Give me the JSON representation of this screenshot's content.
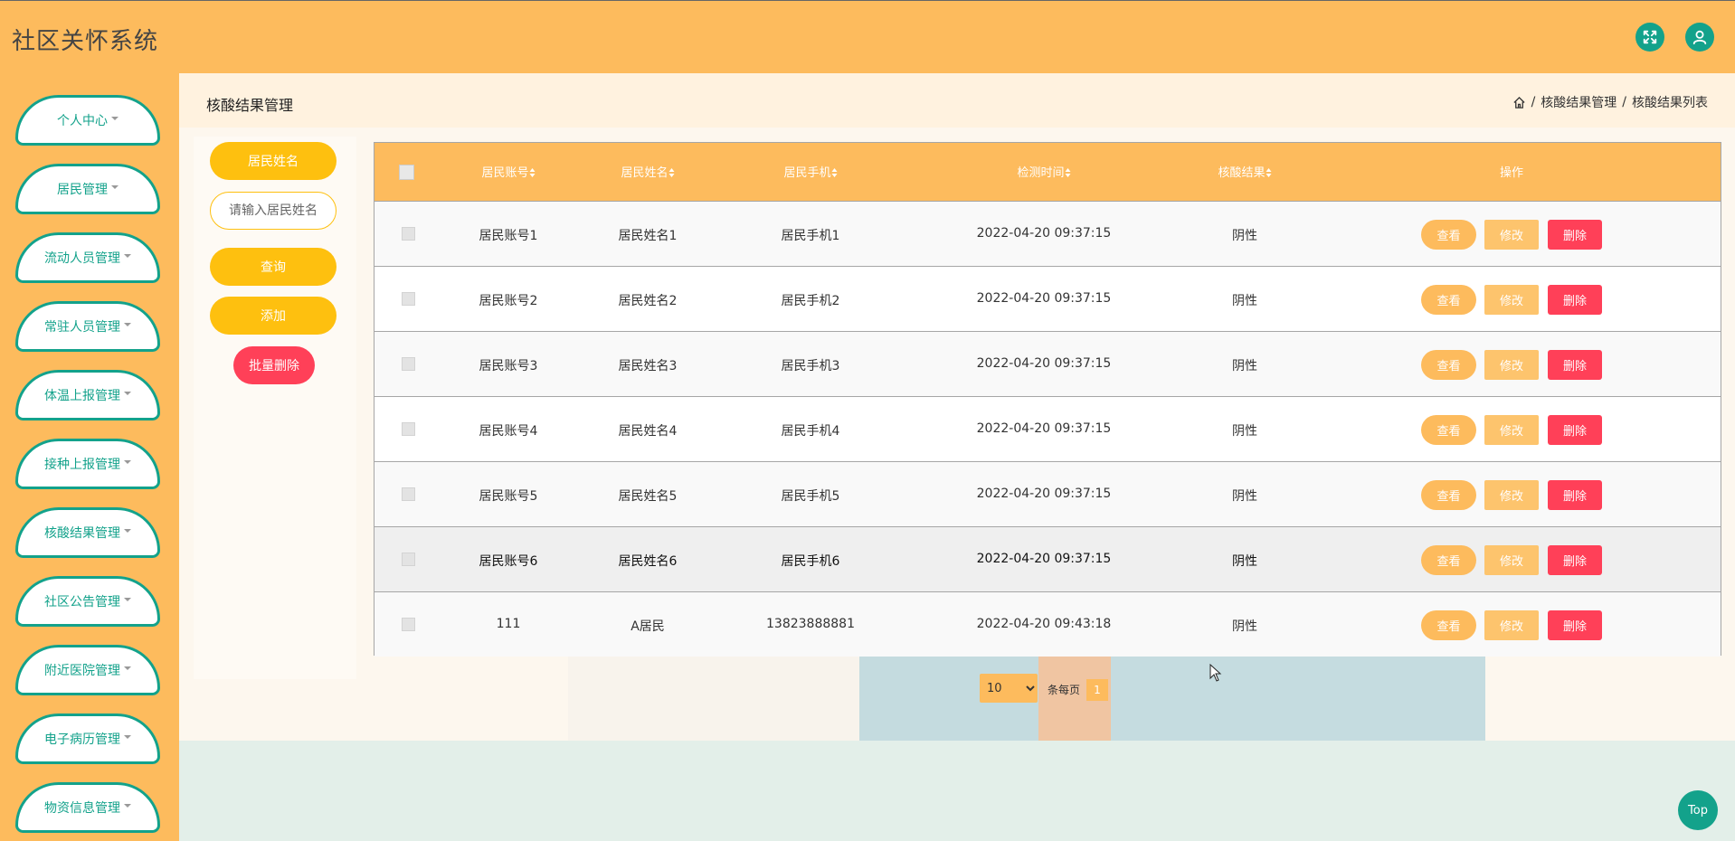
{
  "header": {
    "app_title": "社区关怀系统",
    "accent": "#fdbb5d",
    "teal": "#13a28b",
    "icons": [
      "fullscreen-icon",
      "user-icon"
    ]
  },
  "sidebar": {
    "items": [
      {
        "label": "个人中心"
      },
      {
        "label": "居民管理"
      },
      {
        "label": "流动人员管理"
      },
      {
        "label": "常驻人员管理"
      },
      {
        "label": "体温上报管理"
      },
      {
        "label": "接种上报管理"
      },
      {
        "label": "核酸结果管理"
      },
      {
        "label": "社区公告管理"
      },
      {
        "label": "附近医院管理"
      },
      {
        "label": "电子病历管理"
      },
      {
        "label": "物资信息管理"
      }
    ]
  },
  "page": {
    "title": "核酸结果管理",
    "breadcrumb": [
      "核酸结果管理",
      "核酸结果列表"
    ],
    "separator": "/"
  },
  "filters": {
    "name_label": "居民姓名",
    "name_placeholder": "请输入居民姓名",
    "name_value": "",
    "query_label": "查询",
    "add_label": "添加",
    "batch_delete_label": "批量删除"
  },
  "table": {
    "columns": [
      "居民账号",
      "居民姓名",
      "居民手机",
      "检测时间",
      "核酸结果",
      "操作"
    ],
    "action_labels": {
      "view": "查看",
      "edit": "修改",
      "delete": "删除"
    },
    "rows": [
      {
        "account": "居民账号1",
        "name": "居民姓名1",
        "phone": "居民手机1",
        "time": "2022-04-20 09:37:15",
        "result": "阴性"
      },
      {
        "account": "居民账号2",
        "name": "居民姓名2",
        "phone": "居民手机2",
        "time": "2022-04-20 09:37:15",
        "result": "阴性"
      },
      {
        "account": "居民账号3",
        "name": "居民姓名3",
        "phone": "居民手机3",
        "time": "2022-04-20 09:37:15",
        "result": "阴性"
      },
      {
        "account": "居民账号4",
        "name": "居民姓名4",
        "phone": "居民手机4",
        "time": "2022-04-20 09:37:15",
        "result": "阴性"
      },
      {
        "account": "居民账号5",
        "name": "居民姓名5",
        "phone": "居民手机5",
        "time": "2022-04-20 09:37:15",
        "result": "阴性"
      },
      {
        "account": "居民账号6",
        "name": "居民姓名6",
        "phone": "居民手机6",
        "time": "2022-04-20 09:37:15",
        "result": "阴性"
      },
      {
        "account": "111",
        "name": "A居民",
        "phone": "13823888881",
        "time": "2022-04-20 09:43:18",
        "result": "阴性"
      }
    ]
  },
  "pagination": {
    "page_size": "10",
    "page_size_options": [
      "10"
    ],
    "per_page_label": "条每页",
    "current_page": "1"
  },
  "back_to_top": "Top"
}
